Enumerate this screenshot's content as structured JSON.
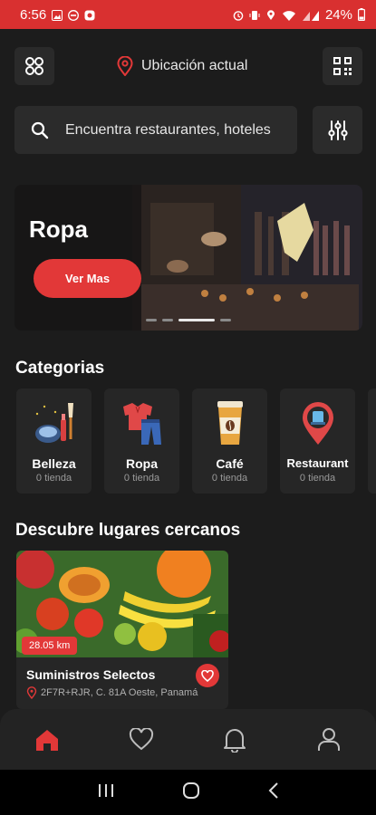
{
  "status_bar": {
    "time": "6:56",
    "battery": "24%"
  },
  "header": {
    "location_label": "Ubicación actual"
  },
  "search": {
    "placeholder": "Encuentra restaurantes, hoteles"
  },
  "banner": {
    "title": "Ropa",
    "button_label": "Ver Mas",
    "active_slide": 3,
    "slides": 4
  },
  "categories": {
    "title": "Categorias",
    "items": [
      {
        "name": "Belleza",
        "count": "0 tienda",
        "icon": "makeup-icon"
      },
      {
        "name": "Ropa",
        "count": "0 tienda",
        "icon": "clothes-icon"
      },
      {
        "name": "Café",
        "count": "0 tienda",
        "icon": "coffee-icon"
      },
      {
        "name": "Restaurant",
        "count": "0 tienda",
        "icon": "restaurant-pin-icon"
      }
    ]
  },
  "nearby": {
    "title": "Descubre lugares cercanos",
    "places": [
      {
        "distance": "28.05 km",
        "name": "Suministros Selectos",
        "address": "2F7R+RJR, C. 81A Oeste, Panamá"
      }
    ]
  },
  "nav": {
    "active": "home-tab",
    "accent": "#e23838"
  }
}
